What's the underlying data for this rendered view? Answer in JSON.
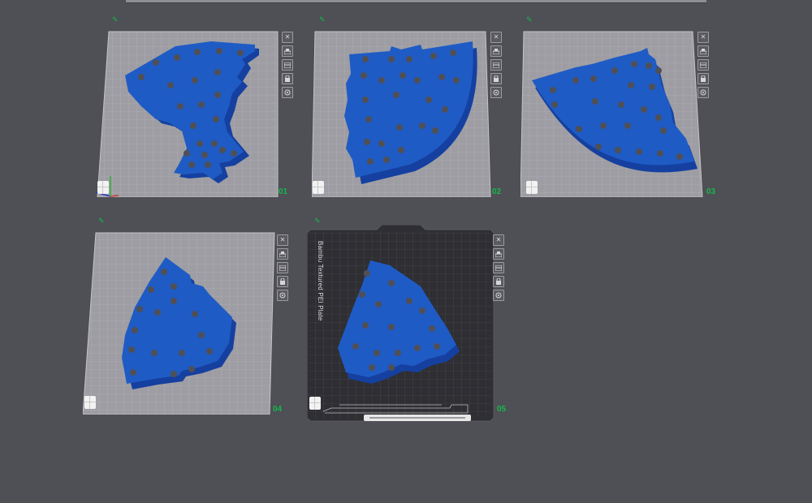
{
  "colors": {
    "background": "#4f4f56",
    "plate_light": "#9c9ca2",
    "plate_dark": "#2f2f33",
    "part_blue": "#1f5bc4",
    "part_blue_dark": "#1540a0",
    "plate_number": "#15b84a"
  },
  "plates": [
    {
      "number": "01",
      "type": "light"
    },
    {
      "number": "02",
      "type": "light"
    },
    {
      "number": "03",
      "type": "light"
    },
    {
      "number": "04",
      "type": "light"
    },
    {
      "number": "05",
      "type": "textured",
      "label": "Bambu Textured PEI Plate"
    }
  ],
  "plate_toolbar": {
    "icons": [
      "close-icon",
      "arrange-icon",
      "orient-icon",
      "lock-icon",
      "settings-icon"
    ]
  },
  "bottom_strip": {
    "left_text": "",
    "right_text": ""
  }
}
